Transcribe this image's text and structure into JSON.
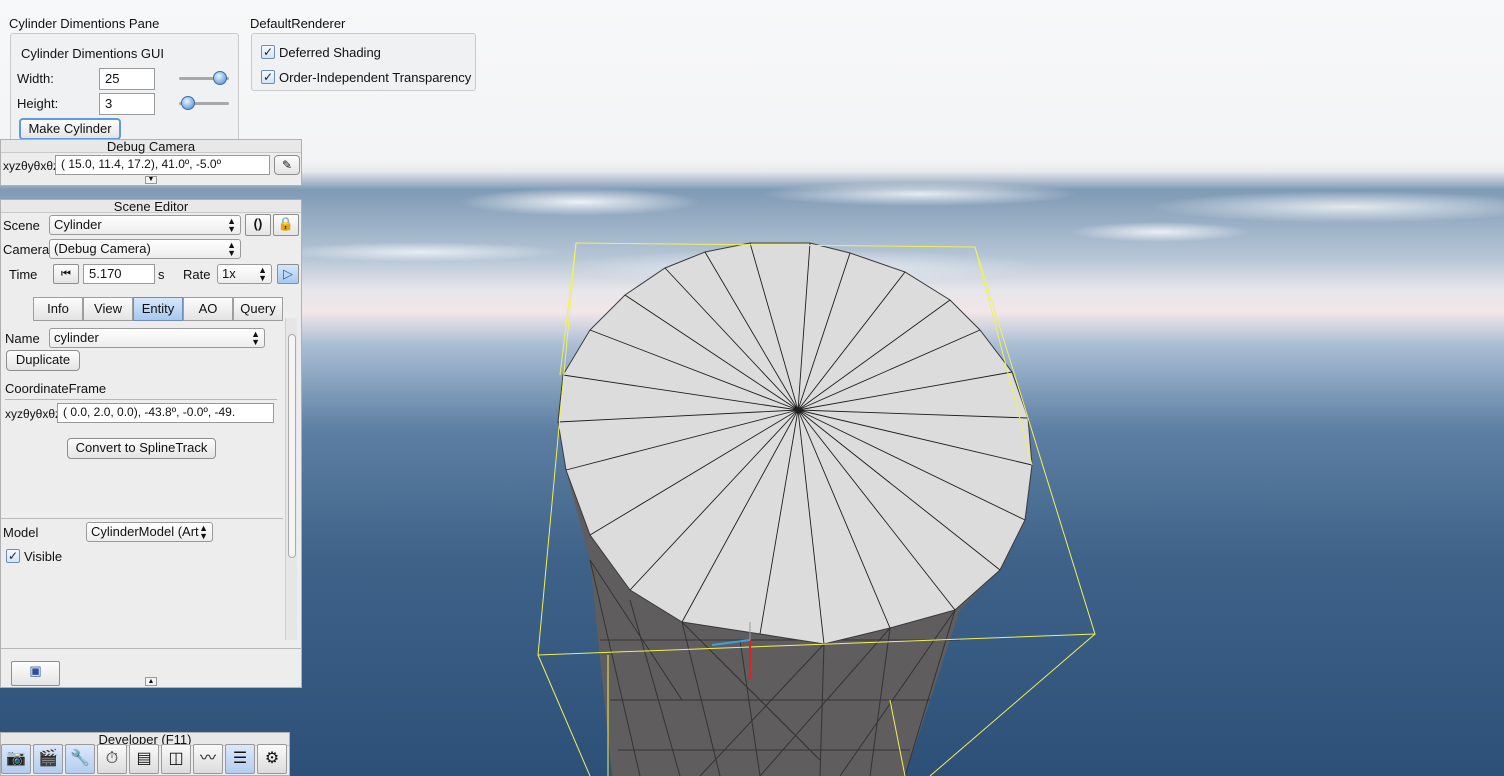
{
  "cylinder_pane": {
    "title": "Cylinder Dimentions Pane",
    "group_title": "Cylinder Dimentions GUI",
    "width_label": "Width:",
    "width_value": "25",
    "width_slider_fraction": 0.93,
    "height_label": "Height:",
    "height_value": "3",
    "height_slider_fraction": 0.12,
    "make_button": "Make Cylinder"
  },
  "renderer_pane": {
    "title": "DefaultRenderer",
    "deferred_label": "Deferred Shading",
    "deferred_checked": true,
    "oit_label": "Order-Independent Transparency",
    "oit_checked": true
  },
  "debug_camera": {
    "title": "Debug Camera",
    "coord_label": "xyzθyθxθz",
    "coord_value": "( 15.0,  11.4,  17.2),  41.0º,  -5.0º"
  },
  "scene_editor": {
    "title": "Scene Editor",
    "scene_label": "Scene",
    "scene_value": "Cylinder",
    "camera_label": "Camera",
    "camera_value": "(Debug Camera)",
    "time_label": "Time",
    "time_value": "5.170",
    "time_unit": "s",
    "rate_label": "Rate",
    "rate_value": "1x",
    "tabs": [
      "Info",
      "View",
      "Entity",
      "AO",
      "Query"
    ],
    "active_tab": "Entity",
    "name_label": "Name",
    "name_value": "cylinder",
    "duplicate_button": "Duplicate",
    "coordinate_frame_label": "CoordinateFrame",
    "frame_coord_label": "xyzθyθxθz",
    "frame_coord_value": "(  0.0,   2.0,   0.0), -43.8º,  -0.0º, -49.",
    "convert_button": "Convert to SplineTrack",
    "model_label": "Model",
    "model_value": "CylinderModel (Art",
    "visible_label": "Visible",
    "visible_checked": true
  },
  "developer": {
    "title": "Developer (F11)",
    "icons": [
      "camera-icon",
      "clapperboard-icon",
      "tools-icon",
      "clock-icon",
      "window-icon",
      "scene-icon",
      "profiler-icon",
      "log-icon",
      "settings-icon"
    ]
  },
  "colors": {
    "accent": "#5b9be0",
    "bounds_box": "#f0f05a",
    "cylinder_top": "#dcdcdd",
    "cylinder_side": "#5f5d5e"
  }
}
